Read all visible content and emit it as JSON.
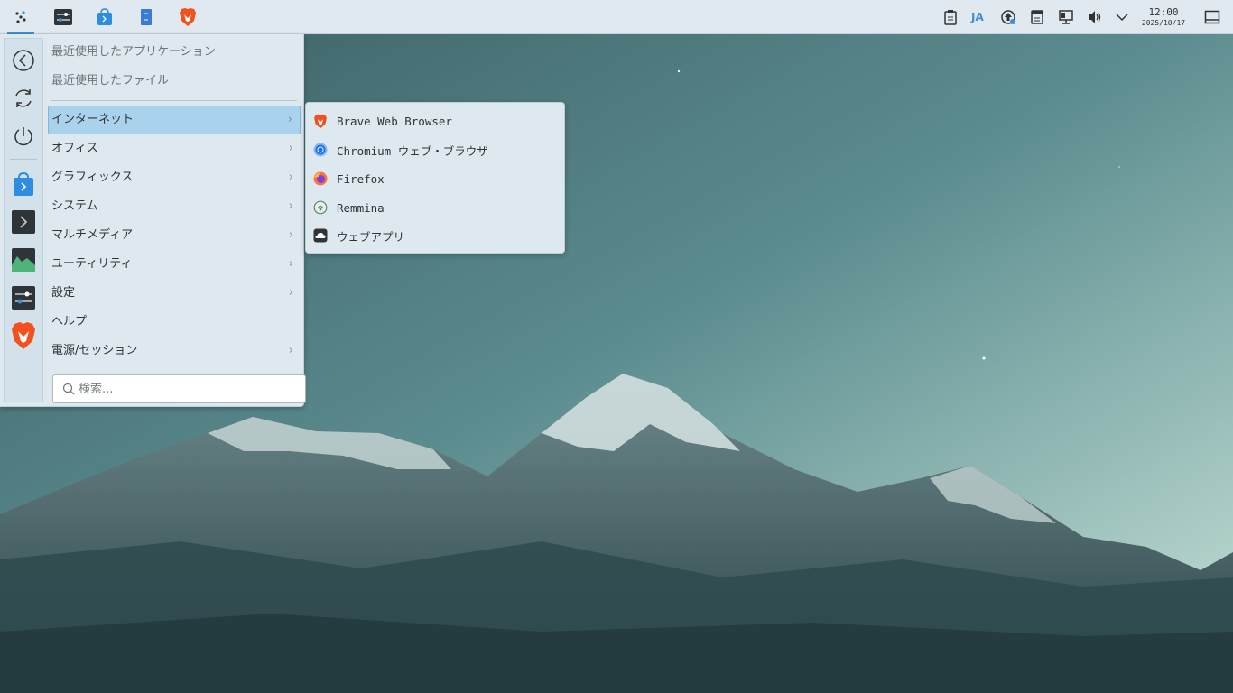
{
  "panel": {
    "input_method": "JA",
    "clock": {
      "time": "12:00",
      "date": "2025/10/17"
    }
  },
  "menu": {
    "categories": [
      {
        "label": "最近使用したアプリケーション",
        "has_submenu": false
      },
      {
        "label": "最近使用したファイル",
        "has_submenu": false
      },
      {
        "label": "インターネット",
        "has_submenu": true,
        "active": true
      },
      {
        "label": "オフィス",
        "has_submenu": true
      },
      {
        "label": "グラフィックス",
        "has_submenu": true
      },
      {
        "label": "システム",
        "has_submenu": true
      },
      {
        "label": "マルチメディア",
        "has_submenu": true
      },
      {
        "label": "ユーティリティ",
        "has_submenu": true
      },
      {
        "label": "設定",
        "has_submenu": true
      },
      {
        "label": "ヘルプ",
        "has_submenu": false
      },
      {
        "label": "電源/セッション",
        "has_submenu": true
      }
    ],
    "search": {
      "placeholder": "検索..."
    }
  },
  "submenu": {
    "items": [
      {
        "label": "Brave Web Browser",
        "icon": "brave-icon"
      },
      {
        "label": "Chromium ウェブ・ブラウザ",
        "icon": "chromium-icon"
      },
      {
        "label": "Firefox",
        "icon": "firefox-icon"
      },
      {
        "label": "Remmina",
        "icon": "remmina-icon"
      },
      {
        "label": "ウェブアプリ",
        "icon": "webapp-icon"
      }
    ]
  },
  "colors": {
    "panel_bg": "#dfe9ef",
    "menu_bg": "#dde9ef",
    "active_item": "#a9d2ec",
    "accent": "#3d8fd6",
    "brave": "#f2501e"
  }
}
